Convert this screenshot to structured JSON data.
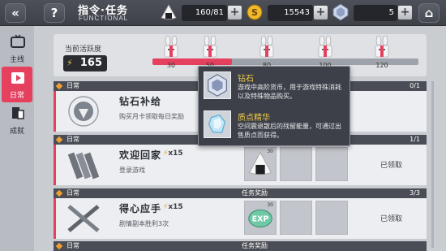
{
  "header": {
    "title": "指令·任务",
    "subtitle": "FUNCTIONAL",
    "back_label": "«",
    "help_label": "?",
    "home_label": "⌂",
    "resources": [
      {
        "icon": "onigiri-icon",
        "value": "160/81",
        "plus": "+"
      },
      {
        "icon": "coin-icon",
        "value": "15543",
        "plus": "+"
      },
      {
        "icon": "diamond-icon",
        "value": "5",
        "plus": "+"
      }
    ]
  },
  "sidebar": {
    "items": [
      {
        "label": "主线",
        "icon": "tv-icon",
        "active": false
      },
      {
        "label": "日常",
        "icon": "play-icon",
        "active": true
      },
      {
        "label": "成就",
        "icon": "trophy-icon",
        "active": false
      }
    ]
  },
  "activity": {
    "label": "当前活跃度",
    "value": "165",
    "progress_fraction": 0.3,
    "milestones": [
      "30",
      "50",
      "80",
      "100",
      "120"
    ]
  },
  "quests": [
    {
      "category": "日常",
      "name": "钻石补给",
      "desc": "购买月卡领取每日奖励",
      "progress": "0/1",
      "multiplier": "",
      "rewards_header": "",
      "rewards": [],
      "status": ""
    },
    {
      "category": "日常",
      "name": "欢迎回家",
      "desc": "登录游戏",
      "progress": "1/1",
      "multiplier": "x15",
      "rewards_header": "",
      "rewards": [
        {
          "icon": "onigiri-icon",
          "count": "30"
        }
      ],
      "status": "已领取"
    },
    {
      "category": "日常",
      "name": "得心应手",
      "desc": "剧情副本胜利3次",
      "progress": "3/3",
      "multiplier": "x15",
      "rewards_header": "任务奖励",
      "rewards": [
        {
          "icon": "exp-icon",
          "count": "30"
        }
      ],
      "status": "已领取"
    },
    {
      "category": "日常",
      "name": "",
      "desc": "",
      "progress": "",
      "multiplier": "",
      "rewards_header": "任务奖励",
      "rewards": [],
      "status": ""
    }
  ],
  "tooltip": {
    "items": [
      {
        "name": "钻石",
        "desc": "游戏中高阶货币，用于游戏特殊消耗以及特殊物品购买。",
        "icon": "diamond-icon"
      },
      {
        "name": "质点精华",
        "desc": "空间震退散后的残留能量，可通过出售质点而获得。",
        "icon": "crystal-icon"
      }
    ]
  },
  "colors": {
    "accent": "#e6405f",
    "header": "#4a4d55",
    "card": "#eceef1",
    "tooltip_title": "#f0c84a"
  }
}
